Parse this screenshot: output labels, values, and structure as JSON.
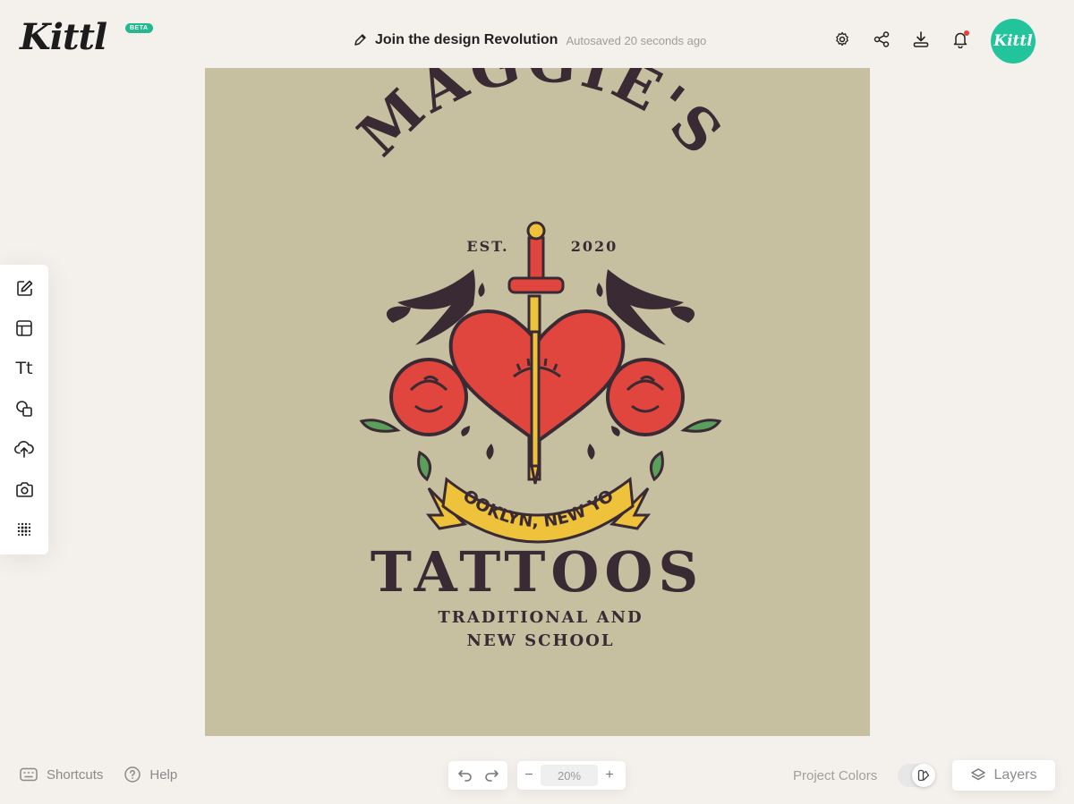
{
  "brand": {
    "logo_text": "Kittl",
    "beta_label": "BETA"
  },
  "header": {
    "project_title": "Join the design Revolution",
    "autosave_status": "Autosaved 20 seconds ago",
    "avatar_text": "Kittl"
  },
  "icons": {
    "edit_title": "pencil-icon",
    "settings": "gear-icon",
    "share": "share-icon",
    "download": "download-icon",
    "notifications": "bell-icon"
  },
  "toolbar": {
    "tools": [
      "edit-icon",
      "templates-icon",
      "text-icon",
      "shapes-icon",
      "upload-icon",
      "camera-icon",
      "grid-dots-icon"
    ],
    "text_tool_glyph": "Tt"
  },
  "canvas": {
    "background_color": "#c6c0a1",
    "design": {
      "headline": "MAGGIE'S",
      "est_left": "EST.",
      "est_right": "2020",
      "banner_text": "BROOKLYN, NEW YORK",
      "main_title": "TATTOOS",
      "tagline_1": "TRADITIONAL AND",
      "tagline_2": "NEW SCHOOL",
      "ink_color": "#3a2a34",
      "heart_color": "#e0463e",
      "banner_color": "#efc23b"
    }
  },
  "footer": {
    "shortcuts_label": "Shortcuts",
    "help_label": "Help",
    "zoom_value": "20%",
    "zoom_minus": "−",
    "zoom_plus": "+",
    "project_colors_label": "Project Colors",
    "layers_label": "Layers"
  },
  "colors": {
    "accent": "#22c59b",
    "background": "#f4f0eb",
    "notification_dot": "#e3413b"
  }
}
